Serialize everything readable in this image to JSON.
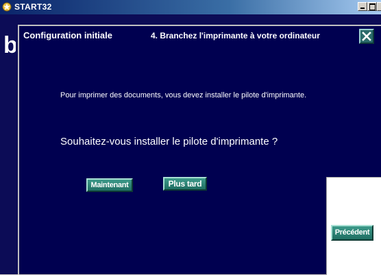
{
  "window": {
    "title": "START32",
    "icon": "app-star-icon"
  },
  "background": {
    "letter": "b"
  },
  "dialog": {
    "title": "Configuration initiale",
    "step": "4. Branchez l'imprimante à votre ordinateur",
    "close_icon": "close-icon",
    "intro": "Pour imprimer des documents, vous devez installer le pilote d'imprimante.",
    "question": "Souhaitez-vous installer le pilote d'imprimante ?",
    "buttons": {
      "now": "Maintenant",
      "later": "Plus tard",
      "previous": "Précédent"
    }
  },
  "colors": {
    "dialog_bg": "#000050",
    "button_teal": "#2a7d70",
    "titlebar": "#0a246a"
  }
}
